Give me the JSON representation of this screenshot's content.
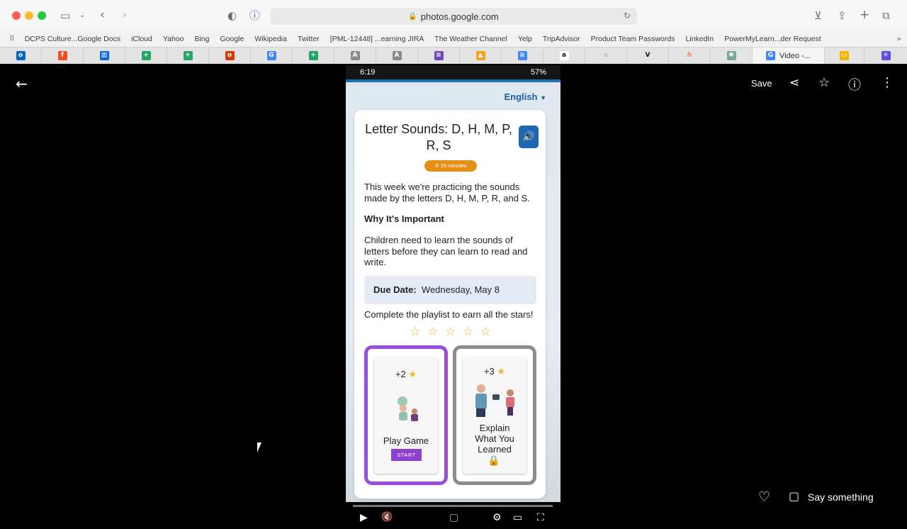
{
  "browser": {
    "url": "photos.google.com",
    "favorites": [
      "DCPS Culture...Google Docs",
      "iCloud",
      "Yahoo",
      "Bing",
      "Google",
      "Wikipedia",
      "Twitter",
      "[PML-12448] ...earning JIRA",
      "The Weather Channel",
      "Yelp",
      "TripAdvisor",
      "Product Team Passwords",
      "LinkedIn",
      "PowerMyLearn...der Request"
    ],
    "active_tab_title": "Video -..."
  },
  "viewer": {
    "save_label": "Save",
    "say_something": "Say something"
  },
  "phone": {
    "time": "6:19",
    "battery": "57%",
    "language": "English",
    "title": "Letter Sounds: D, H, M, P, R, S",
    "duration": "15 minutes",
    "intro": "This week we're practicing the sounds made by the letters D, H, M, P, R, and S.",
    "why_heading": "Why It's Important",
    "why_text": "Children need to learn the sounds of letters before they can learn to read and write.",
    "due_label": "Due Date:",
    "due_value": "Wednesday, May 8",
    "playlist_text": "Complete the playlist to earn all the stars!",
    "stars_earned": 0,
    "stars_total": 5,
    "activities": [
      {
        "points": "+2",
        "label": "Play Game",
        "button": "START"
      },
      {
        "points": "+3",
        "label": "Explain What You Learned"
      }
    ]
  },
  "colors": {
    "accent_blue": "#1d68b4",
    "purple": "#9b4ed9",
    "orange": "#e58f16",
    "star": "#e9b92d"
  }
}
